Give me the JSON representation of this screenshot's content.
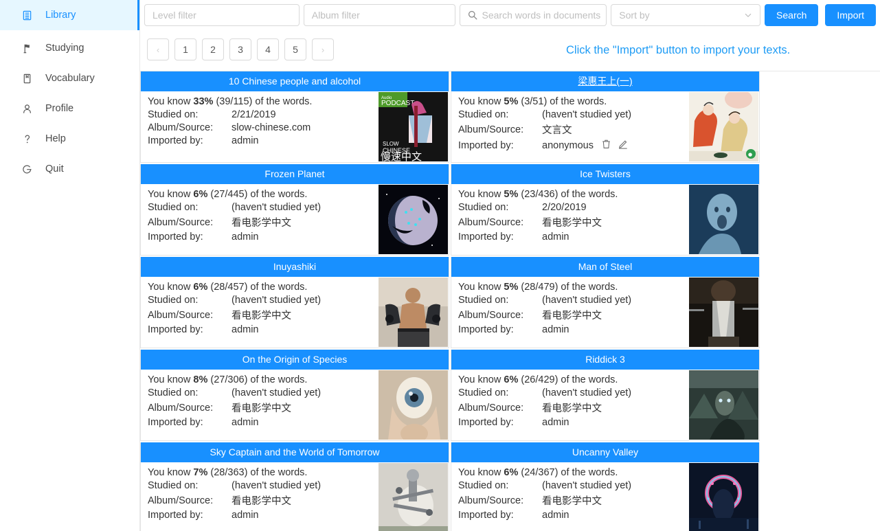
{
  "sidebar": {
    "items": [
      {
        "label": "Library",
        "icon": "library-icon",
        "active": true
      },
      {
        "label": "Studying",
        "icon": "flag-icon",
        "active": false
      },
      {
        "label": "Vocabulary",
        "icon": "book-icon",
        "active": false
      },
      {
        "label": "Profile",
        "icon": "user-icon",
        "active": false
      },
      {
        "label": "Help",
        "icon": "question-icon",
        "active": false
      },
      {
        "label": "Quit",
        "icon": "power-icon",
        "active": false
      }
    ]
  },
  "toolbar": {
    "level_filter_placeholder": "Level filter",
    "level_filter_value": "",
    "album_filter_placeholder": "Album filter",
    "album_filter_value": "",
    "search_placeholder": "Search words in documents",
    "search_value": "",
    "sort_placeholder": "Sort by",
    "sort_value": "",
    "search_button": "Search",
    "import_button": "Import",
    "accent_color": "#1890ff"
  },
  "pagination": {
    "prev": "‹",
    "next": "›",
    "pages": [
      "1",
      "2",
      "3",
      "4",
      "5"
    ],
    "current": "1"
  },
  "annotation": {
    "text": "Click the \"Import\" button to import your texts.",
    "color": "#1e9cf5"
  },
  "labels": {
    "know_prefix": "You know ",
    "know_suffix": " of the words.",
    "studied_on": "Studied on:",
    "album_source": "Album/Source:",
    "imported_by": "Imported by:"
  },
  "cards": [
    {
      "title": "10 Chinese people and alcohol",
      "title_is_link": false,
      "percent": "33%",
      "fraction": "(39/115)",
      "studied_on": "2/21/2019",
      "album": "slow-chinese.com",
      "imported_by": "admin",
      "has_actions": false,
      "thumb": "podcast-slow-chinese"
    },
    {
      "title": "梁惠王上(一)",
      "title_is_link": true,
      "percent": "5%",
      "fraction": "(3/51)",
      "studied_on": "(haven't studied yet)",
      "album": "文言文",
      "imported_by": "anonymous",
      "has_actions": true,
      "thumb": "classical-painting"
    },
    {
      "title": "Frozen Planet",
      "title_is_link": false,
      "percent": "6%",
      "fraction": "(27/445)",
      "studied_on": "(haven't studied yet)",
      "album": "看电影学中文",
      "imported_by": "admin",
      "has_actions": false,
      "thumb": "frozen-planet"
    },
    {
      "title": "Ice Twisters",
      "title_is_link": false,
      "percent": "5%",
      "fraction": "(23/436)",
      "studied_on": "2/20/2019",
      "album": "看电影学中文",
      "imported_by": "admin",
      "has_actions": false,
      "thumb": "ice-twisters"
    },
    {
      "title": "Inuyashiki",
      "title_is_link": false,
      "percent": "6%",
      "fraction": "(28/457)",
      "studied_on": "(haven't studied yet)",
      "album": "看电影学中文",
      "imported_by": "admin",
      "has_actions": false,
      "thumb": "inuyashiki"
    },
    {
      "title": "Man of Steel",
      "title_is_link": false,
      "percent": "5%",
      "fraction": "(28/479)",
      "studied_on": "(haven't studied yet)",
      "album": "看电影学中文",
      "imported_by": "admin",
      "has_actions": false,
      "thumb": "man-of-steel"
    },
    {
      "title": "On the Origin of Species",
      "title_is_link": false,
      "percent": "8%",
      "fraction": "(27/306)",
      "studied_on": "(haven't studied yet)",
      "album": "看电影学中文",
      "imported_by": "admin",
      "has_actions": false,
      "thumb": "origin-of-species"
    },
    {
      "title": "Riddick 3",
      "title_is_link": false,
      "percent": "6%",
      "fraction": "(26/429)",
      "studied_on": "(haven't studied yet)",
      "album": "看电影学中文",
      "imported_by": "admin",
      "has_actions": false,
      "thumb": "riddick"
    },
    {
      "title": "Sky Captain and the World of Tomorrow",
      "title_is_link": false,
      "percent": "7%",
      "fraction": "(28/363)",
      "studied_on": "(haven't studied yet)",
      "album": "看电影学中文",
      "imported_by": "admin",
      "has_actions": false,
      "thumb": "sky-captain"
    },
    {
      "title": "Uncanny Valley",
      "title_is_link": false,
      "percent": "6%",
      "fraction": "(24/367)",
      "studied_on": "(haven't studied yet)",
      "album": "看电影学中文",
      "imported_by": "admin",
      "has_actions": false,
      "thumb": "uncanny-valley"
    }
  ]
}
